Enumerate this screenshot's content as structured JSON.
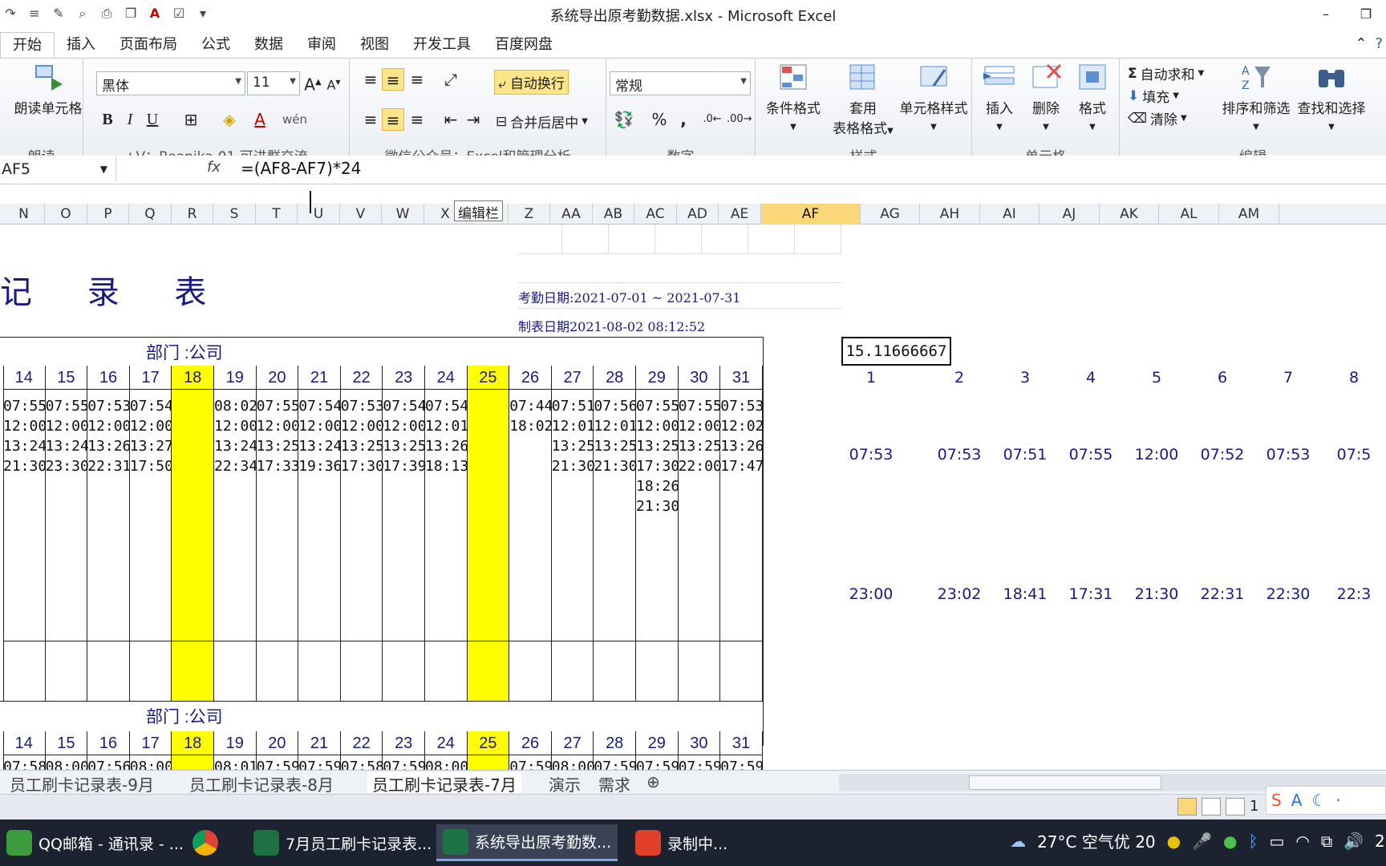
{
  "window": {
    "title": "系统导出原考勤数据.xlsx - Microsoft Excel"
  },
  "ribbon_tabs": [
    "开始",
    "插入",
    "页面布局",
    "公式",
    "数据",
    "审阅",
    "视图",
    "开发工具",
    "百度网盘"
  ],
  "ribbon": {
    "read_cell": "朗读单元格",
    "read_group": "朗读",
    "font_name": "黑体",
    "font_size": "11",
    "font_group": "+V：Reanika-01 可进群交流",
    "wrap_text": "自动换行",
    "merge_center": "合并后居中",
    "align_group": "微信公众号：Excel和管理分析",
    "number_format": "常规",
    "number_group": "数字",
    "cond_format": "条件格式",
    "table_format_1": "套用",
    "table_format_2": "表格格式",
    "cell_style": "单元格样式",
    "style_group": "样式",
    "insert": "插入",
    "delete": "删除",
    "format": "格式",
    "cells_group": "单元格",
    "autosum": "自动求和",
    "fill": "填充",
    "clear": "清除",
    "sort_filter": "排序和筛选",
    "find_select": "查找和选择",
    "edit_group": "编辑",
    "bold": "B",
    "italic": "I",
    "underline": "U",
    "percent": "%",
    "comma": ","
  },
  "formula_bar": {
    "name_box": "AF5",
    "fx": "fx",
    "formula": "=(AF8-AF7)*24",
    "tooltip": "编辑栏"
  },
  "columns": [
    "N",
    "O",
    "P",
    "Q",
    "R",
    "S",
    "T",
    "U",
    "V",
    "W",
    "X",
    "Y",
    "Z",
    "AA",
    "AB",
    "AC",
    "AD",
    "AE",
    "AF",
    "AG",
    "AH",
    "AI",
    "AJ",
    "AK",
    "AL",
    "AM"
  ],
  "sheet": {
    "title": "记 录 表",
    "attendance_date": "考勤日期:2021-07-01 ~ 2021-07-31",
    "made_date": "制表日期2021-08-02 08:12:52",
    "dept_label": "部门 :公司",
    "af5_value": "15.11666667",
    "days": [
      "14",
      "15",
      "16",
      "17",
      "18",
      "19",
      "20",
      "21",
      "22",
      "23",
      "24",
      "25",
      "26",
      "27",
      "28",
      "29",
      "30",
      "31"
    ],
    "block1_times": [
      "07:55\n12:00\n13:24\n21:30",
      "07:55\n12:00\n13:24\n23:30",
      "07:53\n12:00\n13:26\n22:31",
      "07:54\n12:00\n13:27\n17:50",
      "",
      "08:02\n12:00\n13:24\n22:34",
      "07:55\n12:00\n13:25\n17:33",
      "07:54\n12:00\n13:24\n19:36",
      "07:53\n12:00\n13:25\n17:30",
      "07:54\n12:00\n13:25\n17:39",
      "07:54\n12:01\n13:26\n18:13",
      "",
      "07:44\n18:02",
      "07:51\n12:01\n13:25\n21:30",
      "07:56\n12:01\n13:25\n21:30",
      "07:55\n12:00\n13:25\n17:30\n18:26\n21:30",
      "07:55\n12:00\n13:25\n22:00",
      "07:53\n12:02\n13:26\n17:47"
    ],
    "block2_first_row": [
      "07:58",
      "08:00",
      "07:56",
      "08:00",
      "",
      "08:01",
      "07:59",
      "07:59",
      "07:58",
      "07:59",
      "08:00",
      "",
      "07:59",
      "08:00",
      "07:59",
      "07:59",
      "07:59",
      "07:59"
    ],
    "right_numbers": [
      "1",
      "2",
      "3",
      "4",
      "5",
      "6",
      "7",
      "8"
    ],
    "right_in_times": [
      "07:53",
      "07:53",
      "07:51",
      "07:55",
      "12:00",
      "07:52",
      "07:53",
      "07:5"
    ],
    "right_out_times": [
      "23:00",
      "23:02",
      "18:41",
      "17:31",
      "21:30",
      "22:31",
      "22:30",
      "22:3"
    ]
  },
  "sheet_tabs": [
    "员工刷卡记录表-9月",
    "员工刷卡记录表-8月",
    "员工刷卡记录表-7月",
    "演示",
    "需求"
  ],
  "status": {
    "page": "1"
  },
  "taskbar": {
    "items": [
      "QQ邮箱 - 通讯录 - ...",
      "7月员工刷卡记录表...",
      "系统导出原考勤数...",
      "录制中..."
    ],
    "weather": "27°C 空气优 20",
    "clock_fragment": "2"
  },
  "colors": {
    "yellow": "#ffff00",
    "accent_text": "#1a1a80",
    "selected_header": "#fbd779"
  }
}
